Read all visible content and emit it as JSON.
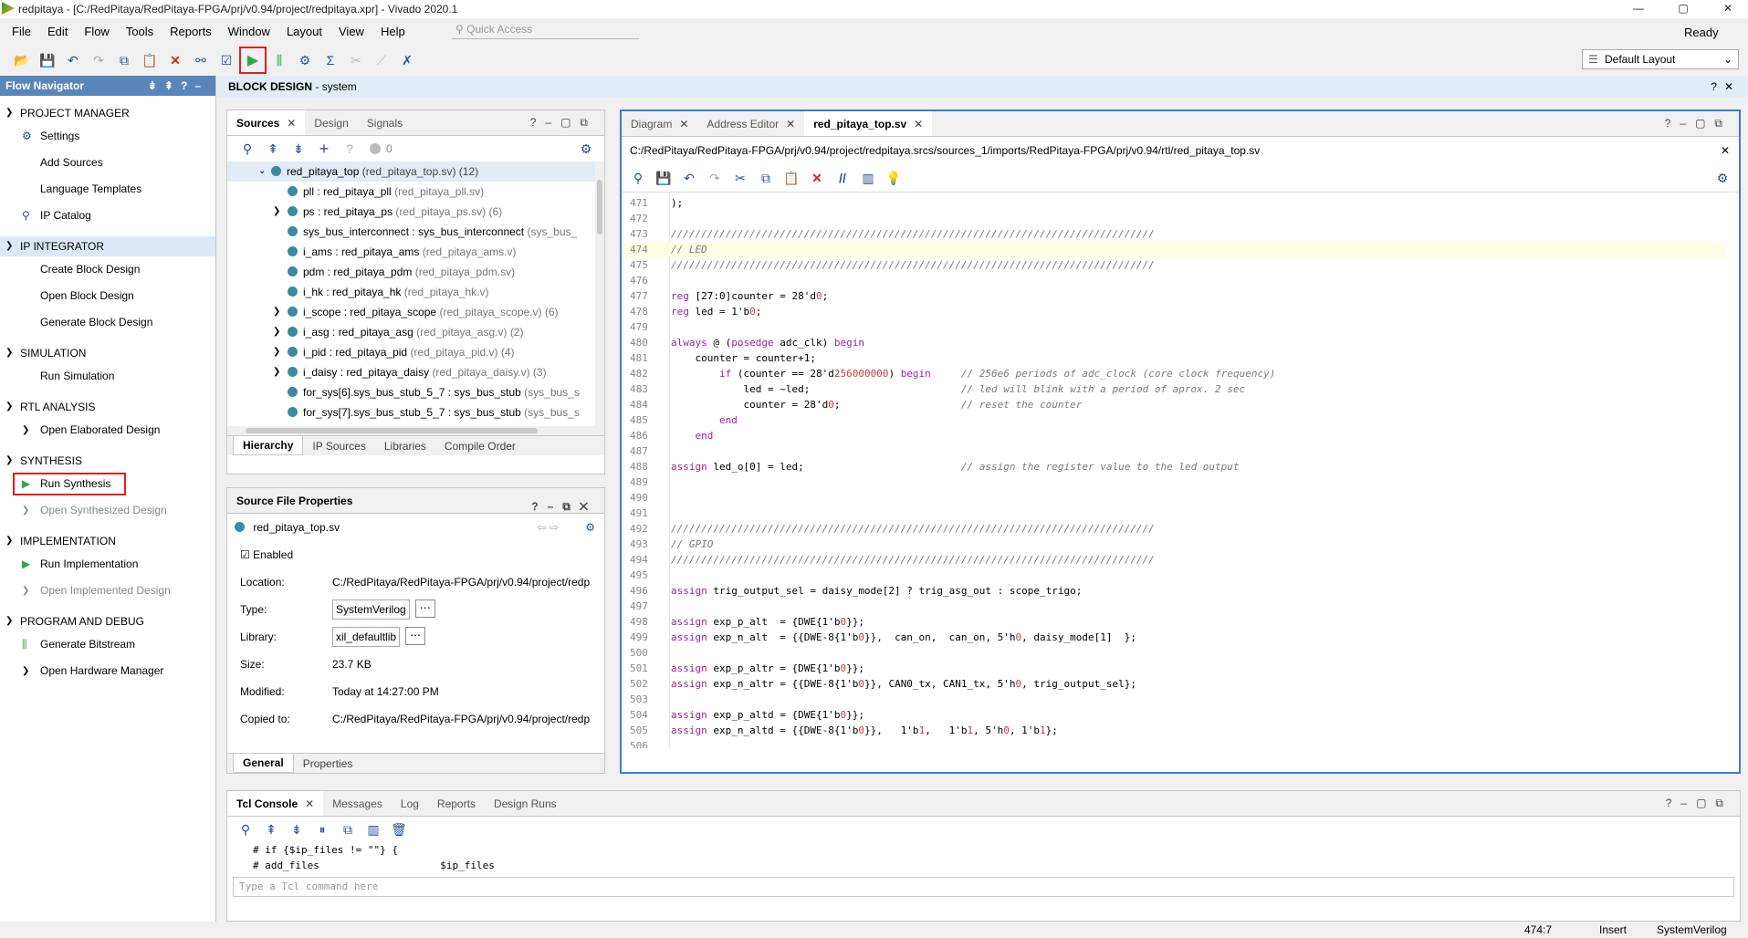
{
  "window": {
    "title": "redpitaya - [C:/RedPitaya/RedPitaya-FPGA/prj/v0.94/project/redpitaya.xpr] - Vivado 2020.1",
    "status": "Ready",
    "controls": {
      "minimize": "—",
      "maximize": "▢",
      "close": "✕"
    }
  },
  "menu": [
    "File",
    "Edit",
    "Flow",
    "Tools",
    "Reports",
    "Window",
    "Layout",
    "View",
    "Help"
  ],
  "quick_access": {
    "placeholder": "Quick Access"
  },
  "layout_selector": {
    "value": "Default Layout"
  },
  "flow_navigator": {
    "title": "Flow Navigator",
    "sections": [
      {
        "label": "PROJECT MANAGER",
        "items": [
          {
            "label": "Settings",
            "icon": "gear-icon"
          },
          {
            "label": "Add Sources"
          },
          {
            "label": "Language Templates"
          },
          {
            "label": "IP Catalog",
            "icon": "plug-icon"
          }
        ]
      },
      {
        "label": "IP INTEGRATOR",
        "items": [
          {
            "label": "Create Block Design"
          },
          {
            "label": "Open Block Design"
          },
          {
            "label": "Generate Block Design"
          }
        ]
      },
      {
        "label": "SIMULATION",
        "items": [
          {
            "label": "Run Simulation"
          }
        ]
      },
      {
        "label": "RTL ANALYSIS",
        "items": [
          {
            "label": "Open Elaborated Design"
          }
        ]
      },
      {
        "label": "SYNTHESIS",
        "items": [
          {
            "label": "Run Synthesis",
            "icon": "play-icon"
          },
          {
            "label": "Open Synthesized Design"
          }
        ]
      },
      {
        "label": "IMPLEMENTATION",
        "items": [
          {
            "label": "Run Implementation",
            "icon": "play-icon"
          },
          {
            "label": "Open Implemented Design"
          }
        ]
      },
      {
        "label": "PROGRAM AND DEBUG",
        "items": [
          {
            "label": "Generate Bitstream",
            "icon": "bitstream-icon"
          },
          {
            "label": "Open Hardware Manager"
          }
        ]
      }
    ]
  },
  "block_design": {
    "title": "BLOCK DESIGN",
    "name": "system"
  },
  "sources": {
    "tabs": [
      "Sources",
      "Design",
      "Signals"
    ],
    "count": "0",
    "tree": [
      {
        "name": "red_pitaya_top",
        "file": "(red_pitaya_top.sv) (12)"
      },
      {
        "name": "pll : red_pitaya_pll",
        "file": "(red_pitaya_pll.sv)"
      },
      {
        "name": "ps : red_pitaya_ps",
        "file": "(red_pitaya_ps.sv) (6)"
      },
      {
        "name": "sys_bus_interconnect : sys_bus_interconnect",
        "file": "(sys_bus_"
      },
      {
        "name": "i_ams : red_pitaya_ams",
        "file": "(red_pitaya_ams.v)"
      },
      {
        "name": "pdm : red_pitaya_pdm",
        "file": "(red_pitaya_pdm.sv)"
      },
      {
        "name": "i_hk : red_pitaya_hk",
        "file": "(red_pitaya_hk.v)"
      },
      {
        "name": "i_scope : red_pitaya_scope",
        "file": "(red_pitaya_scope.v) (6)"
      },
      {
        "name": "i_asg : red_pitaya_asg",
        "file": "(red_pitaya_asg.v) (2)"
      },
      {
        "name": "i_pid : red_pitaya_pid",
        "file": "(red_pitaya_pid.v) (4)"
      },
      {
        "name": "i_daisy : red_pitaya_daisy",
        "file": "(red_pitaya_daisy.v) (3)"
      },
      {
        "name": "for_sys[6].sys_bus_stub_5_7 : sys_bus_stub",
        "file": "(sys_bus_s"
      },
      {
        "name": "for_sys[7].sys_bus_stub_5_7 : sys_bus_stub",
        "file": "(sys_bus_s"
      }
    ],
    "bottom_tabs": [
      "Hierarchy",
      "IP Sources",
      "Libraries",
      "Compile Order"
    ]
  },
  "source_props": {
    "title": "Source File Properties",
    "file": "red_pitaya_top.sv",
    "enabled_label": "Enabled",
    "rows": {
      "location_label": "Location:",
      "location": "C:/RedPitaya/RedPitaya-FPGA/prj/v0.94/project/redp",
      "type_label": "Type:",
      "type": "SystemVerilog",
      "library_label": "Library:",
      "library": "xil_defaultlib",
      "size_label": "Size:",
      "size": "23.7 KB",
      "modified_label": "Modified:",
      "modified": "Today at 14:27:00 PM",
      "copied_label": "Copied to:",
      "copied": "C:/RedPitaya/RedPitaya-FPGA/prj/v0.94/project/redp"
    },
    "bottom_tabs": [
      "General",
      "Properties"
    ]
  },
  "editor": {
    "tabs": [
      "Diagram",
      "Address Editor",
      "red_pitaya_top.sv"
    ],
    "path": "C:/RedPitaya/RedPitaya-FPGA/prj/v0.94/project/redpitaya.srcs/sources_1/imports/RedPitaya-FPGA/prj/v0.94/rtl/red_pitaya_top.sv",
    "lines": [
      {
        "n": "471",
        "t": ");"
      },
      {
        "n": "472",
        "t": ""
      },
      {
        "n": "473",
        "t": "////////////////////////////////////////////////////////////////////////////////"
      },
      {
        "n": "474",
        "t": "// LED"
      },
      {
        "n": "475",
        "t": "////////////////////////////////////////////////////////////////////////////////"
      },
      {
        "n": "476",
        "t": ""
      },
      {
        "n": "477",
        "t": "reg [27:0]counter = 28'd0;"
      },
      {
        "n": "478",
        "t": "reg led = 1'b0;"
      },
      {
        "n": "479",
        "t": ""
      },
      {
        "n": "480",
        "t": "always @ (posedge adc_clk) begin"
      },
      {
        "n": "481",
        "t": "    counter = counter+1;"
      },
      {
        "n": "482",
        "t": "        if (counter == 28'd256000000) begin     // 256e6 periods of adc_clock (core clock frequency)"
      },
      {
        "n": "483",
        "t": "            led = ~led;                         // led will blink with a period of aprox. 2 sec"
      },
      {
        "n": "484",
        "t": "            counter = 28'd0;                    // reset the counter"
      },
      {
        "n": "485",
        "t": "        end"
      },
      {
        "n": "486",
        "t": "    end"
      },
      {
        "n": "487",
        "t": ""
      },
      {
        "n": "488",
        "t": "assign led_o[0] = led;                          // assign the register value to the led output"
      },
      {
        "n": "489",
        "t": ""
      },
      {
        "n": "490",
        "t": ""
      },
      {
        "n": "491",
        "t": ""
      },
      {
        "n": "492",
        "t": "////////////////////////////////////////////////////////////////////////////////"
      },
      {
        "n": "493",
        "t": "// GPIO"
      },
      {
        "n": "494",
        "t": "////////////////////////////////////////////////////////////////////////////////"
      },
      {
        "n": "495",
        "t": ""
      },
      {
        "n": "496",
        "t": "assign trig_output_sel = daisy_mode[2] ? trig_asg_out : scope_trigo;"
      },
      {
        "n": "497",
        "t": ""
      },
      {
        "n": "498",
        "t": "assign exp_p_alt  = {DWE{1'b0}};"
      },
      {
        "n": "499",
        "t": "assign exp_n_alt  = {{DWE-8{1'b0}},  can_on,  can_on, 5'h0, daisy_mode[1]  };"
      },
      {
        "n": "500",
        "t": ""
      },
      {
        "n": "501",
        "t": "assign exp_p_altr = {DWE{1'b0}};"
      },
      {
        "n": "502",
        "t": "assign exp_n_altr = {{DWE-8{1'b0}}, CAN0_tx, CAN1_tx, 5'h0, trig_output_sel};"
      },
      {
        "n": "503",
        "t": ""
      },
      {
        "n": "504",
        "t": "assign exp_p_altd = {DWE{1'b0}};"
      },
      {
        "n": "505",
        "t": "assign exp_n_altd = {{DWE-8{1'b0}},   1'b1,   1'b1, 5'h0, 1'b1};"
      },
      {
        "n": "506",
        "t": ""
      }
    ]
  },
  "tcl": {
    "tabs": [
      "Tcl Console",
      "Messages",
      "Log",
      "Reports",
      "Design Runs"
    ],
    "lines": [
      "# if {$ip_files != \"\"} {",
      "# add_files                    $ip_files"
    ],
    "input_placeholder": "Type a Tcl command here"
  },
  "status": {
    "position": "474:7",
    "mode": "Insert",
    "language": "SystemVerilog"
  },
  "colors": {
    "accent": "#3f7ad1",
    "highlight_red": "#e02020",
    "nav_header": "#5a85b9",
    "run_green": "#2ea84a"
  }
}
